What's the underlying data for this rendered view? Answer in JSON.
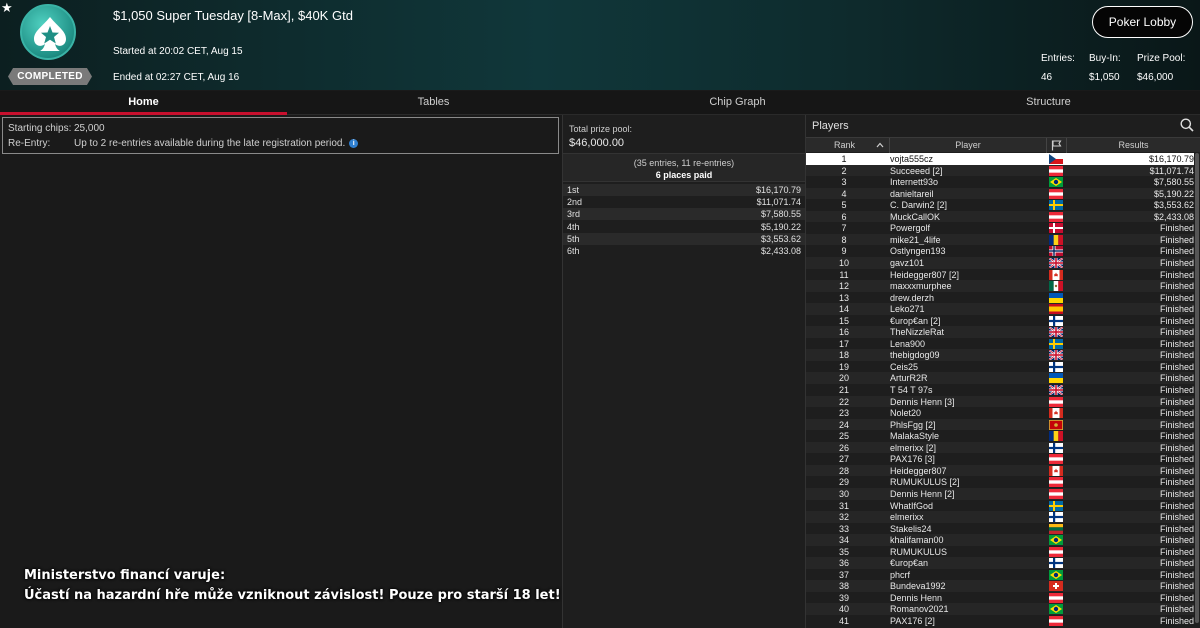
{
  "header": {
    "favorite_icon": "star-icon",
    "logo_icon": "spade-star-icon",
    "status_badge": "COMPLETED",
    "title": "$1,050 Super Tuesday [8-Max], $40K Gtd",
    "started": "Started at 20:02 CET, Aug 15",
    "ended": "Ended at 02:27 CET, Aug 16",
    "lobby_button": "Poker Lobby",
    "stats": [
      {
        "label": "Entries:",
        "value": "46"
      },
      {
        "label": "Buy-In:",
        "value": "$1,050"
      },
      {
        "label": "Prize Pool:",
        "value": "$46,000"
      }
    ]
  },
  "tabs": [
    {
      "label": "Home"
    },
    {
      "label": "Tables"
    },
    {
      "label": "Chip Graph"
    },
    {
      "label": "Structure"
    }
  ],
  "info": {
    "starting_chips_label": "Starting chips:",
    "starting_chips": "25,000",
    "reentry_label": "Re-Entry:",
    "reentry_text": "Up to 2 re-entries available during the late registration period.",
    "info_icon": "info-icon"
  },
  "prize": {
    "total_label": "Total prize pool:",
    "total_value": "$46,000.00",
    "entries_text": "(35 entries, 11 re-entries)",
    "places_text": "6 places paid",
    "places": [
      {
        "place": "1st",
        "amount": "$16,170.79"
      },
      {
        "place": "2nd",
        "amount": "$11,071.74"
      },
      {
        "place": "3rd",
        "amount": "$7,580.55"
      },
      {
        "place": "4th",
        "amount": "$5,190.22"
      },
      {
        "place": "5th",
        "amount": "$3,553.62"
      },
      {
        "place": "6th",
        "amount": "$2,433.08"
      }
    ]
  },
  "players": {
    "title": "Players",
    "search_icon": "search-icon",
    "columns": {
      "rank": "Rank",
      "player": "Player",
      "flag": "flag-icon",
      "results": "Results"
    },
    "sort_icon": "chevron-up-icon",
    "colors": {
      "selected_row": "#ffffff",
      "accent": "#c8102e"
    },
    "rows": [
      {
        "rank": "1",
        "name": "vojta555cz",
        "flag": "cz",
        "result": "$16,170.79"
      },
      {
        "rank": "2",
        "name": "Succeeed [2]",
        "flag": "at",
        "result": "$11,071.74"
      },
      {
        "rank": "3",
        "name": "Internett93o",
        "flag": "br",
        "result": "$7,580.55"
      },
      {
        "rank": "4",
        "name": "danieltareil",
        "flag": "at",
        "result": "$5,190.22"
      },
      {
        "rank": "5",
        "name": "C. Darwin2 [2]",
        "flag": "se",
        "result": "$3,553.62"
      },
      {
        "rank": "6",
        "name": "MuckCallOK",
        "flag": "at",
        "result": "$2,433.08"
      },
      {
        "rank": "7",
        "name": "Powergolf",
        "flag": "dk",
        "result": "Finished"
      },
      {
        "rank": "8",
        "name": "mike21_4life",
        "flag": "ro",
        "result": "Finished"
      },
      {
        "rank": "9",
        "name": "Ostlyngen193",
        "flag": "no",
        "result": "Finished"
      },
      {
        "rank": "10",
        "name": "gavz101",
        "flag": "gb",
        "result": "Finished"
      },
      {
        "rank": "11",
        "name": "Heidegger807 [2]",
        "flag": "ca",
        "result": "Finished"
      },
      {
        "rank": "12",
        "name": "maxxxmurphee",
        "flag": "mx",
        "result": "Finished"
      },
      {
        "rank": "13",
        "name": "drew.derzh",
        "flag": "ua",
        "result": "Finished"
      },
      {
        "rank": "14",
        "name": "Leko271",
        "flag": "es",
        "result": "Finished"
      },
      {
        "rank": "15",
        "name": "€urop€an [2]",
        "flag": "fi",
        "result": "Finished"
      },
      {
        "rank": "16",
        "name": "TheNizzleRat",
        "flag": "gb",
        "result": "Finished"
      },
      {
        "rank": "17",
        "name": "Lena900",
        "flag": "se",
        "result": "Finished"
      },
      {
        "rank": "18",
        "name": "thebigdog09",
        "flag": "gb",
        "result": "Finished"
      },
      {
        "rank": "19",
        "name": "Ceis25",
        "flag": "fi",
        "result": "Finished"
      },
      {
        "rank": "20",
        "name": "ArturR2R",
        "flag": "ua",
        "result": "Finished"
      },
      {
        "rank": "21",
        "name": "T 54 T 97s",
        "flag": "gb",
        "result": "Finished"
      },
      {
        "rank": "22",
        "name": "Dennis Henn [3]",
        "flag": "at",
        "result": "Finished"
      },
      {
        "rank": "23",
        "name": "Nolet20",
        "flag": "ca",
        "result": "Finished"
      },
      {
        "rank": "24",
        "name": "PhlsFgg [2]",
        "flag": "me",
        "result": "Finished"
      },
      {
        "rank": "25",
        "name": "MalakaStyle",
        "flag": "ro",
        "result": "Finished"
      },
      {
        "rank": "26",
        "name": "elmerixx [2]",
        "flag": "fi",
        "result": "Finished"
      },
      {
        "rank": "27",
        "name": "PAX176 [3]",
        "flag": "at",
        "result": "Finished"
      },
      {
        "rank": "28",
        "name": "Heidegger807",
        "flag": "ca",
        "result": "Finished"
      },
      {
        "rank": "29",
        "name": "RUMUKULUS [2]",
        "flag": "at",
        "result": "Finished"
      },
      {
        "rank": "30",
        "name": "Dennis Henn [2]",
        "flag": "at",
        "result": "Finished"
      },
      {
        "rank": "31",
        "name": "WhatIfGod",
        "flag": "se",
        "result": "Finished"
      },
      {
        "rank": "32",
        "name": "elmerixx",
        "flag": "fi",
        "result": "Finished"
      },
      {
        "rank": "33",
        "name": "Stakelis24",
        "flag": "lt",
        "result": "Finished"
      },
      {
        "rank": "34",
        "name": "khalifaman00",
        "flag": "br",
        "result": "Finished"
      },
      {
        "rank": "35",
        "name": "RUMUKULUS",
        "flag": "at",
        "result": "Finished"
      },
      {
        "rank": "36",
        "name": "€urop€an",
        "flag": "fi",
        "result": "Finished"
      },
      {
        "rank": "37",
        "name": "phcrf",
        "flag": "br",
        "result": "Finished"
      },
      {
        "rank": "38",
        "name": "Bundeva1992",
        "flag": "ch",
        "result": "Finished"
      },
      {
        "rank": "39",
        "name": "Dennis Henn",
        "flag": "at",
        "result": "Finished"
      },
      {
        "rank": "40",
        "name": "Romanov2021",
        "flag": "br",
        "result": "Finished"
      },
      {
        "rank": "41",
        "name": "PAX176 [2]",
        "flag": "at",
        "result": "Finished"
      }
    ]
  },
  "warning": {
    "line1": "Ministerstvo financí varuje:",
    "line2": "Účastí na hazardní hře může vzniknout závislost! Pouze pro starší 18 let!"
  }
}
